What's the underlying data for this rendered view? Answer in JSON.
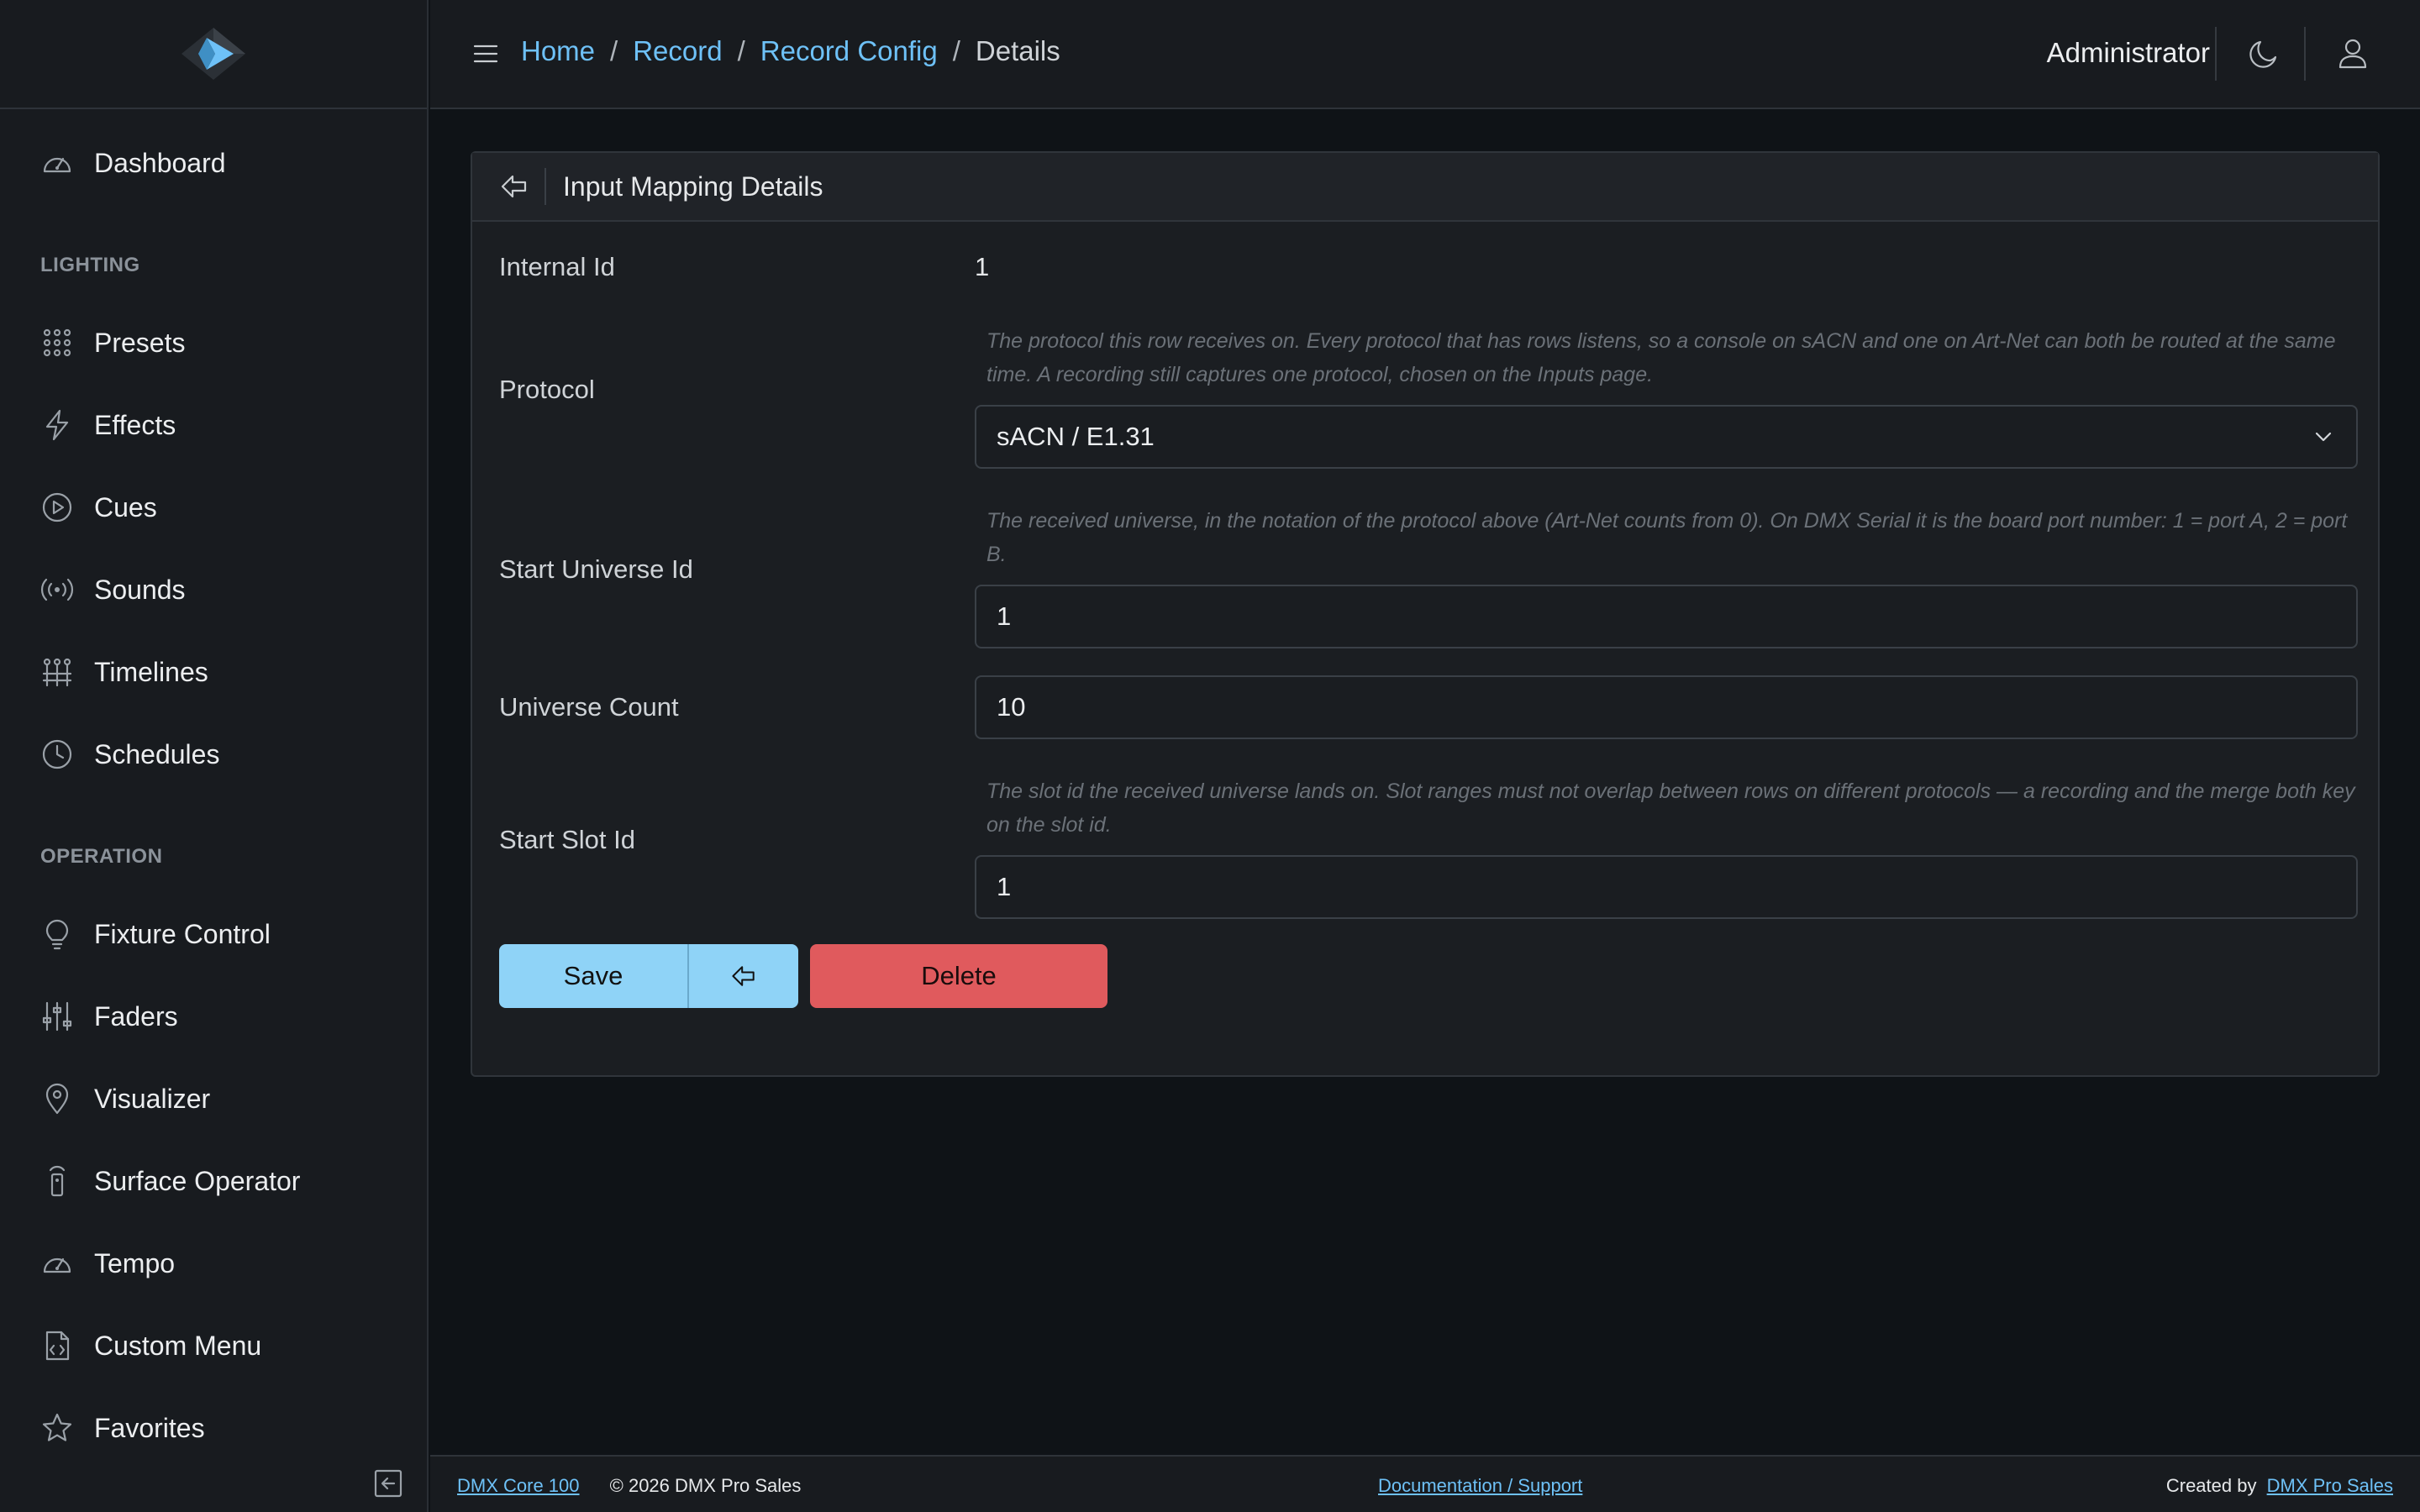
{
  "header": {
    "breadcrumb": [
      {
        "label": "Home"
      },
      {
        "label": "Record"
      },
      {
        "label": "Record Config"
      }
    ],
    "breadcrumb_current": "Details",
    "breadcrumb_separator": "/",
    "user_name": "Administrator"
  },
  "sidebar": {
    "items_top": [
      {
        "label": "Dashboard",
        "icon": "gauge-icon"
      }
    ],
    "section_lighting": "LIGHTING",
    "lighting_items": [
      {
        "label": "Presets",
        "icon": "grid-dots-icon"
      },
      {
        "label": "Effects",
        "icon": "lightning-icon"
      },
      {
        "label": "Cues",
        "icon": "play-circle-icon"
      },
      {
        "label": "Sounds",
        "icon": "broadcast-icon"
      },
      {
        "label": "Timelines",
        "icon": "timeline-icon"
      },
      {
        "label": "Schedules",
        "icon": "clock-icon"
      }
    ],
    "section_operation": "OPERATION",
    "operation_items": [
      {
        "label": "Fixture Control",
        "icon": "lightbulb-icon"
      },
      {
        "label": "Faders",
        "icon": "sliders-icon"
      },
      {
        "label": "Visualizer",
        "icon": "map-pin-icon"
      },
      {
        "label": "Surface Operator",
        "icon": "remote-icon"
      },
      {
        "label": "Tempo",
        "icon": "gauge-icon"
      },
      {
        "label": "Custom Menu",
        "icon": "code-file-icon"
      },
      {
        "label": "Favorites",
        "icon": "star-icon"
      }
    ]
  },
  "card": {
    "title": "Input Mapping Details",
    "internal_id_label": "Internal Id",
    "internal_id_value": "1",
    "protocol_label": "Protocol",
    "protocol_help": "The protocol this row receives on. Every protocol that has rows listens, so a console on sACN and one on Art-Net can both be routed at the same time. A recording still captures one protocol, chosen on the Inputs page.",
    "protocol_value": "sACN / E1.31",
    "start_universe_label": "Start Universe Id",
    "start_universe_help": "The received universe, in the notation of the protocol above (Art-Net counts from 0). On DMX Serial it is the board port number: 1 = port A, 2 = port B.",
    "start_universe_value": "1",
    "universe_count_label": "Universe Count",
    "universe_count_value": "10",
    "start_slot_label": "Start Slot Id",
    "start_slot_help": "The slot id the received universe lands on. Slot ranges must not overlap between rows on different protocols — a recording and the merge both key on the slot id.",
    "start_slot_value": "1",
    "save_label": "Save",
    "delete_label": "Delete"
  },
  "footer": {
    "product_link": "DMX Core 100",
    "copyright": "© 2026 DMX Pro Sales",
    "docs_link": "Documentation / Support",
    "created_by": "Created by",
    "company_link": "DMX Pro Sales"
  },
  "colors": {
    "accent": "#6ec1f7",
    "save": "#8fd3f7",
    "delete": "#e05a5d",
    "background": "#0f1317"
  }
}
